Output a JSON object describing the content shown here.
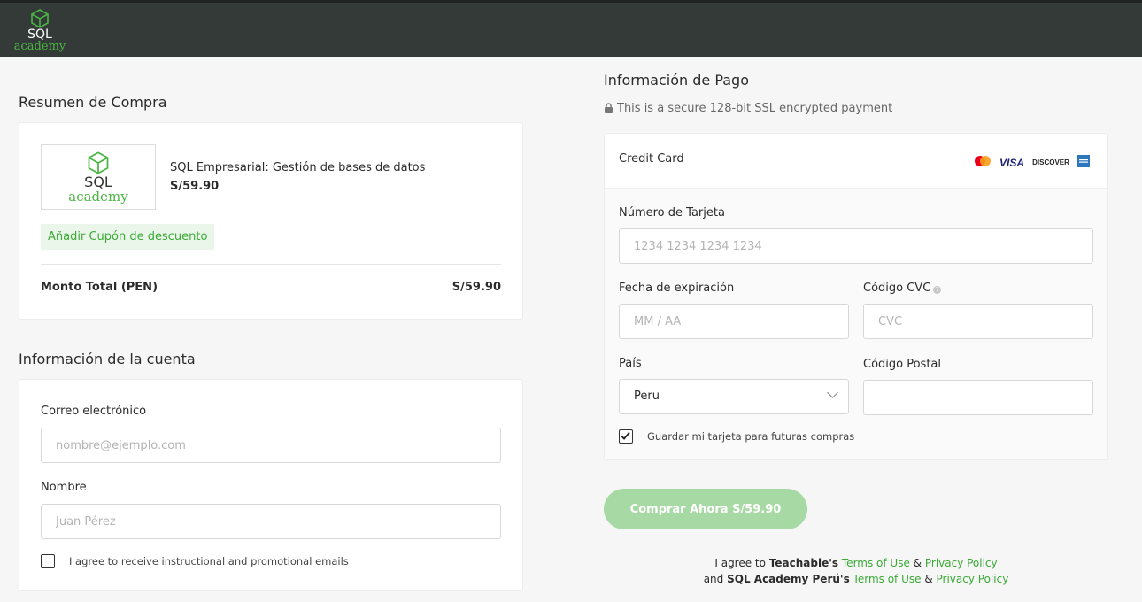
{
  "brand": {
    "line1": "SQL",
    "line2": "academy"
  },
  "summary": {
    "title": "Resumen de Compra",
    "product_logo_line1": "SQL",
    "product_logo_line2": "academy",
    "product_name": "SQL Empresarial: Gestión de bases de datos",
    "product_price": "S/59.90",
    "coupon_label": "Añadir Cupón de descuento",
    "total_label": "Monto Total (PEN)",
    "total_value": "S/59.90"
  },
  "account": {
    "title": "Información de la cuenta",
    "email_label": "Correo electrónico",
    "email_placeholder": "nombre@ejemplo.com",
    "name_label": "Nombre",
    "name_placeholder": "Juan Pérez",
    "marketing_label": "I agree to receive instructional and promotional emails",
    "marketing_checked": false
  },
  "payment": {
    "title": "Información de Pago",
    "secure_text": "This is a secure 128-bit SSL encrypted payment",
    "method_label": "Credit Card",
    "card_brands": [
      "mastercard-icon",
      "VISA",
      "DISCOVER",
      "amex-icon"
    ],
    "card_number_label": "Número de Tarjeta",
    "card_number_placeholder": "1234 1234 1234 1234",
    "expiry_label": "Fecha de expiración",
    "expiry_placeholder": "MM / AA",
    "cvc_label": "Código CVC",
    "cvc_placeholder": "CVC",
    "country_label": "País",
    "country_value": "Peru",
    "postal_label": "Código Postal",
    "postal_placeholder": "",
    "save_card_label": "Guardar mi tarjeta para futuras compras",
    "save_card_checked": true
  },
  "buy_button_label": "Comprar Ahora S/59.90",
  "legal": {
    "line1_prefix": "I agree to",
    "line1_company": "Teachable's",
    "line2_prefix": "and",
    "line2_company": "SQL Academy Perú's",
    "terms": "Terms of Use",
    "amp": "&",
    "privacy": "Privacy Policy"
  },
  "colors": {
    "accent": "#3aaa35",
    "topbar": "#333a38",
    "button_disabled": "#a6d9a3"
  }
}
